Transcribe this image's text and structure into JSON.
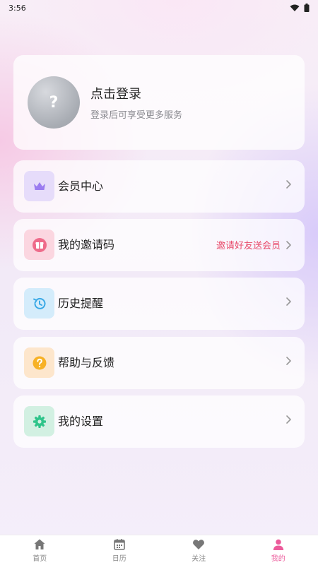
{
  "status_bar": {
    "time": "3:56"
  },
  "profile": {
    "avatar_text": "?",
    "title": "点击登录",
    "subtitle": "登录后可享受更多服务"
  },
  "menu": [
    {
      "label": "会员中心",
      "icon": "crown-icon",
      "icon_bg": "#e6dcfa",
      "icon_color": "#9b7cf0",
      "extra": ""
    },
    {
      "label": "我的邀请码",
      "icon": "gift-icon",
      "icon_bg": "#fbd6e0",
      "icon_color": "#ee6b8a",
      "extra": "邀请好友送会员"
    },
    {
      "label": "历史提醒",
      "icon": "history-icon",
      "icon_bg": "#d4ecfb",
      "icon_color": "#3aa9e6",
      "extra": ""
    },
    {
      "label": "帮助与反馈",
      "icon": "help-icon",
      "icon_bg": "#fde6cc",
      "icon_color": "#f7b125",
      "extra": ""
    },
    {
      "label": "我的设置",
      "icon": "gear-icon",
      "icon_bg": "#d2f0e2",
      "icon_color": "#2fc48a",
      "extra": ""
    }
  ],
  "tabs": [
    {
      "label": "首页",
      "icon": "home-icon",
      "active": false
    },
    {
      "label": "日历",
      "icon": "calendar-icon",
      "active": false
    },
    {
      "label": "关注",
      "icon": "heart-icon",
      "active": false
    },
    {
      "label": "我的",
      "icon": "person-icon",
      "active": true
    }
  ],
  "colors": {
    "accent": "#ec5b9b",
    "inactive": "#888888",
    "extra_text": "#e84a6a"
  }
}
